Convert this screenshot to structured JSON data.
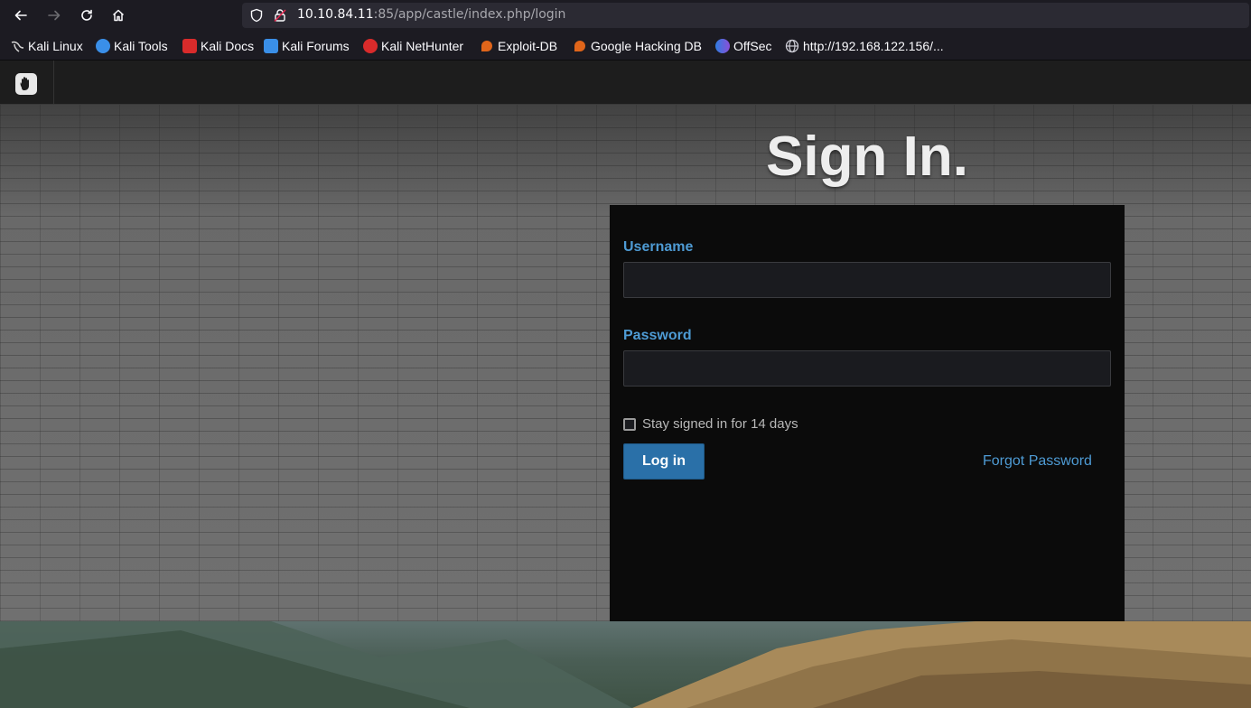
{
  "browser": {
    "url_host": "10.10.84.11",
    "url_rest": ":85/app/castle/index.php/login",
    "bookmarks": [
      {
        "label": "Kali Linux",
        "icon": "kali-dragon-icon",
        "color": "#d0d0d0"
      },
      {
        "label": "Kali Tools",
        "icon": "kali-tools-icon",
        "color": "#3a8fe8"
      },
      {
        "label": "Kali Docs",
        "icon": "kali-docs-icon",
        "color": "#d92b2b"
      },
      {
        "label": "Kali Forums",
        "icon": "kali-forums-icon",
        "color": "#3a8fe8"
      },
      {
        "label": "Kali NetHunter",
        "icon": "nethunter-icon",
        "color": "#d92b2b"
      },
      {
        "label": "Exploit-DB",
        "icon": "exploit-db-icon",
        "color": "#e0651a"
      },
      {
        "label": "Google Hacking DB",
        "icon": "ghdb-icon",
        "color": "#e0651a"
      },
      {
        "label": "OffSec",
        "icon": "offsec-icon",
        "color": "#6a5acd"
      },
      {
        "label": "http://192.168.122.156/...",
        "icon": "globe-icon",
        "color": "#cfcfd8"
      }
    ]
  },
  "app": {
    "logo_icon": "hand-logo-icon"
  },
  "login": {
    "title": "Sign In.",
    "username_label": "Username",
    "password_label": "Password",
    "username_value": "",
    "password_value": "",
    "remember_label": "Stay signed in for 14 days",
    "remember_checked": false,
    "login_button": "Log in",
    "forgot_link": "Forgot Password"
  },
  "colors": {
    "accent": "#4e9bd4",
    "button": "#2a70a8",
    "panel": "#0b0b0b"
  }
}
